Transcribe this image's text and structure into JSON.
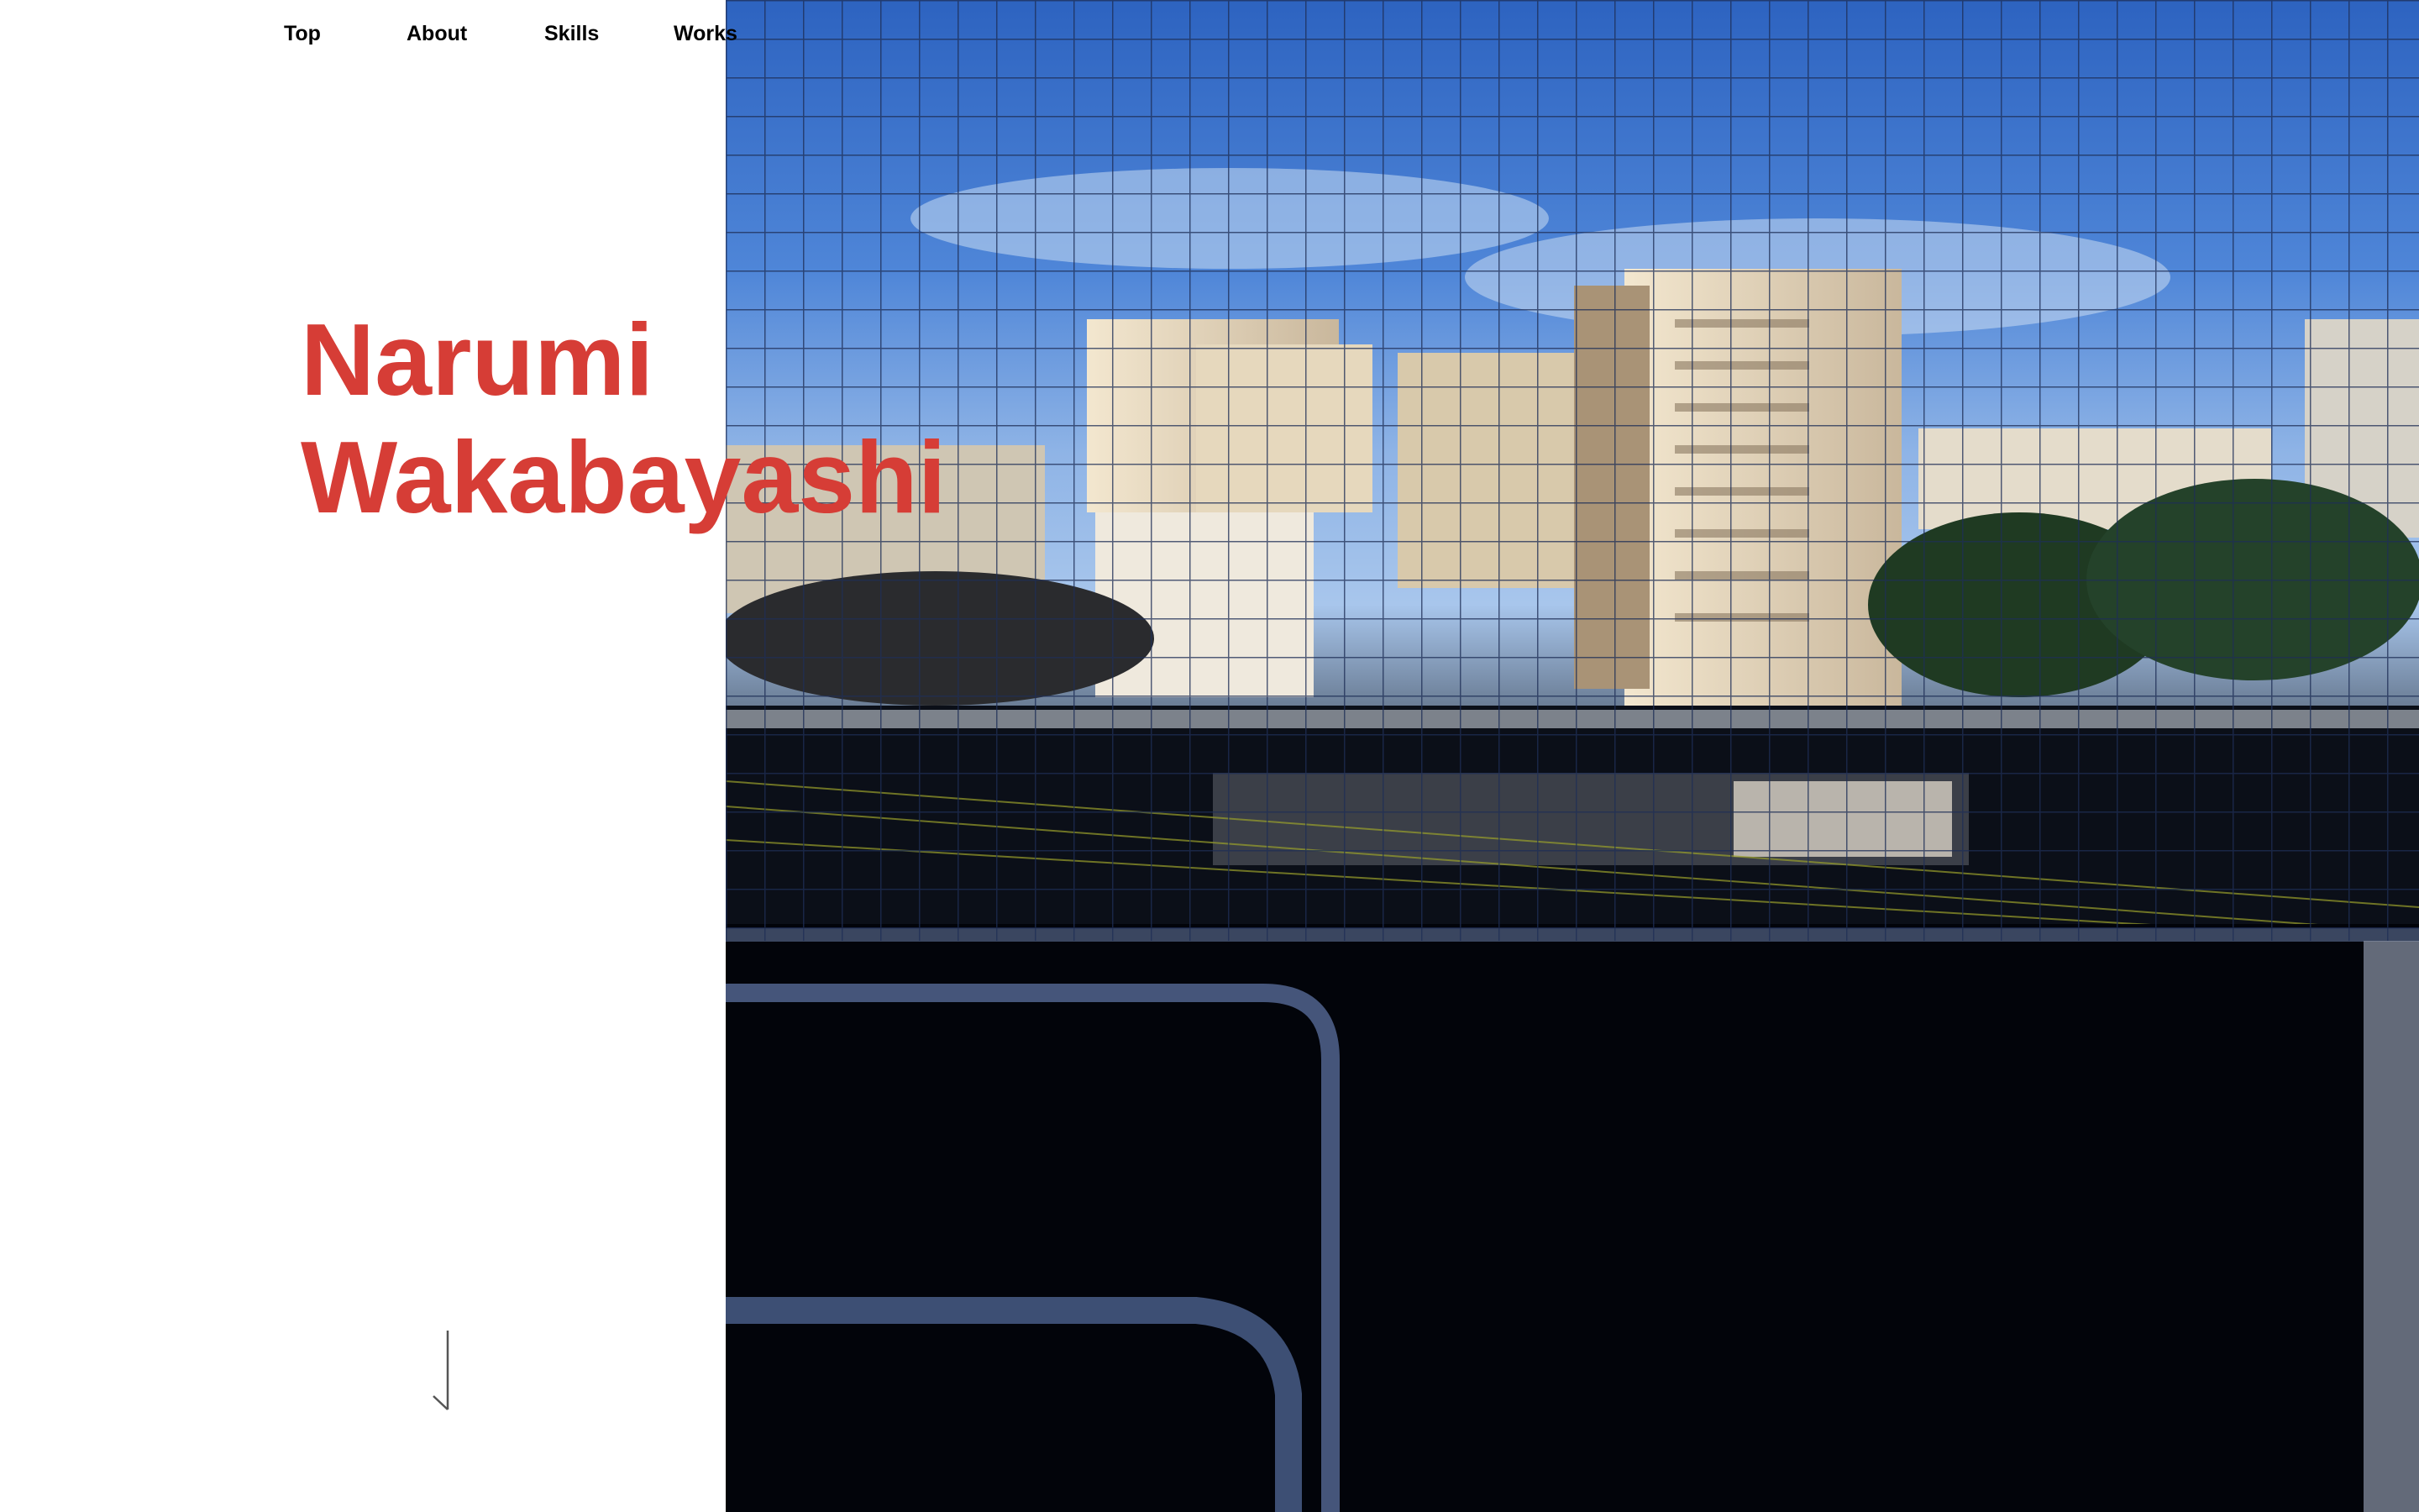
{
  "nav": {
    "items": [
      {
        "label": "Top"
      },
      {
        "label": "About"
      },
      {
        "label": "Skills"
      },
      {
        "label": "Works"
      }
    ]
  },
  "hero": {
    "first_name": "Narumi",
    "last_name": "Wakabayashi"
  },
  "colors": {
    "name_accent": "#d63d36",
    "nav_text": "#000000",
    "background": "#ffffff"
  },
  "icons": {
    "scroll": "arrow-down-icon"
  },
  "photo": {
    "subject": "city-view-through-net-photo"
  }
}
